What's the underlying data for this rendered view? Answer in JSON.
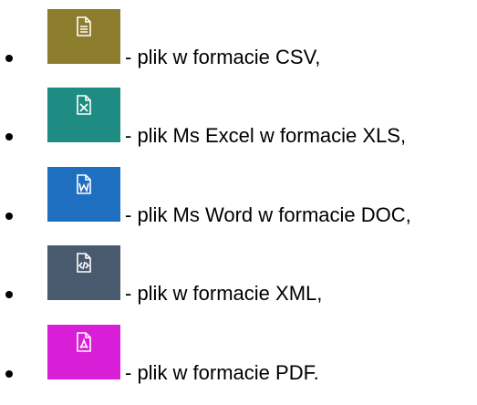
{
  "items": [
    {
      "label": "- plik w formacie CSV,",
      "icon": "csv-file-icon",
      "color": "#8B7D2C"
    },
    {
      "label": "- plik Ms Excel w formacie XLS,",
      "icon": "xls-file-icon",
      "color": "#1E8C82"
    },
    {
      "label": "- plik Ms Word w formacie DOC,",
      "icon": "doc-file-icon",
      "color": "#1F6FC0"
    },
    {
      "label": "- plik w formacie XML,",
      "icon": "xml-file-icon",
      "color": "#4A5A6E"
    },
    {
      "label": "- plik w formacie PDF.",
      "icon": "pdf-file-icon",
      "color": "#D91ED8"
    }
  ]
}
